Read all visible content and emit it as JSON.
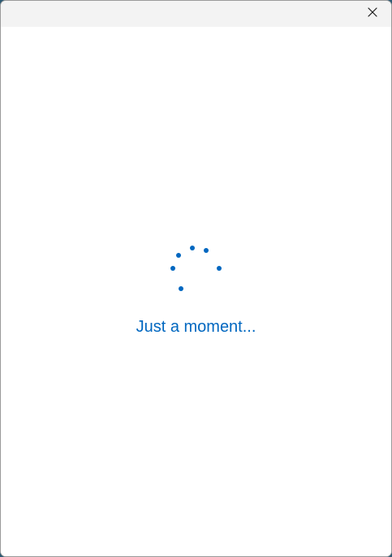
{
  "window": {
    "close_icon": "close-icon",
    "accent_color": "#0067c0"
  },
  "loading": {
    "message": "Just a moment...",
    "spinner_icon": "loading-dots-icon"
  }
}
